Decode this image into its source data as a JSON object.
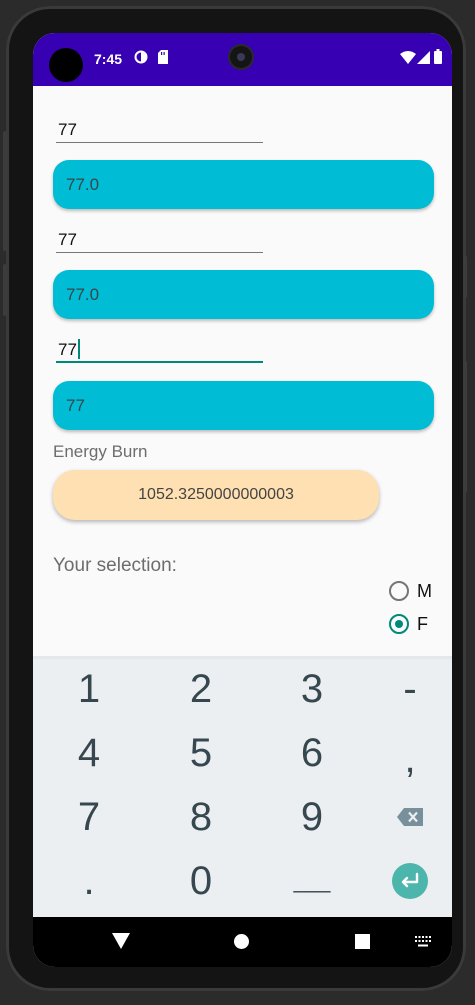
{
  "status_bar": {
    "time": "7:45"
  },
  "form": {
    "field1_value": "77",
    "field1_result": "77.0",
    "field2_value": "77",
    "field2_result": "77.0",
    "field3_value": "77",
    "field3_result": "77",
    "energy_label": "Energy Burn",
    "energy_value": "1052.3250000000003",
    "selection_label": "Your selection:",
    "gender_options": [
      {
        "label": "M",
        "checked": false
      },
      {
        "label": "F",
        "checked": true
      }
    ]
  },
  "keyboard": {
    "keys": [
      "1",
      "2",
      "3",
      "-",
      "4",
      "5",
      "6",
      ",",
      "7",
      "8",
      "9",
      "backspace-icon",
      ".",
      "0",
      "___",
      "enter-icon"
    ],
    "accent_color": "#4db6ac"
  },
  "colors": {
    "status_bar": "#3700b3",
    "pill": "#00bcd4",
    "result": "#ffe0b2",
    "accent": "#00897b"
  }
}
